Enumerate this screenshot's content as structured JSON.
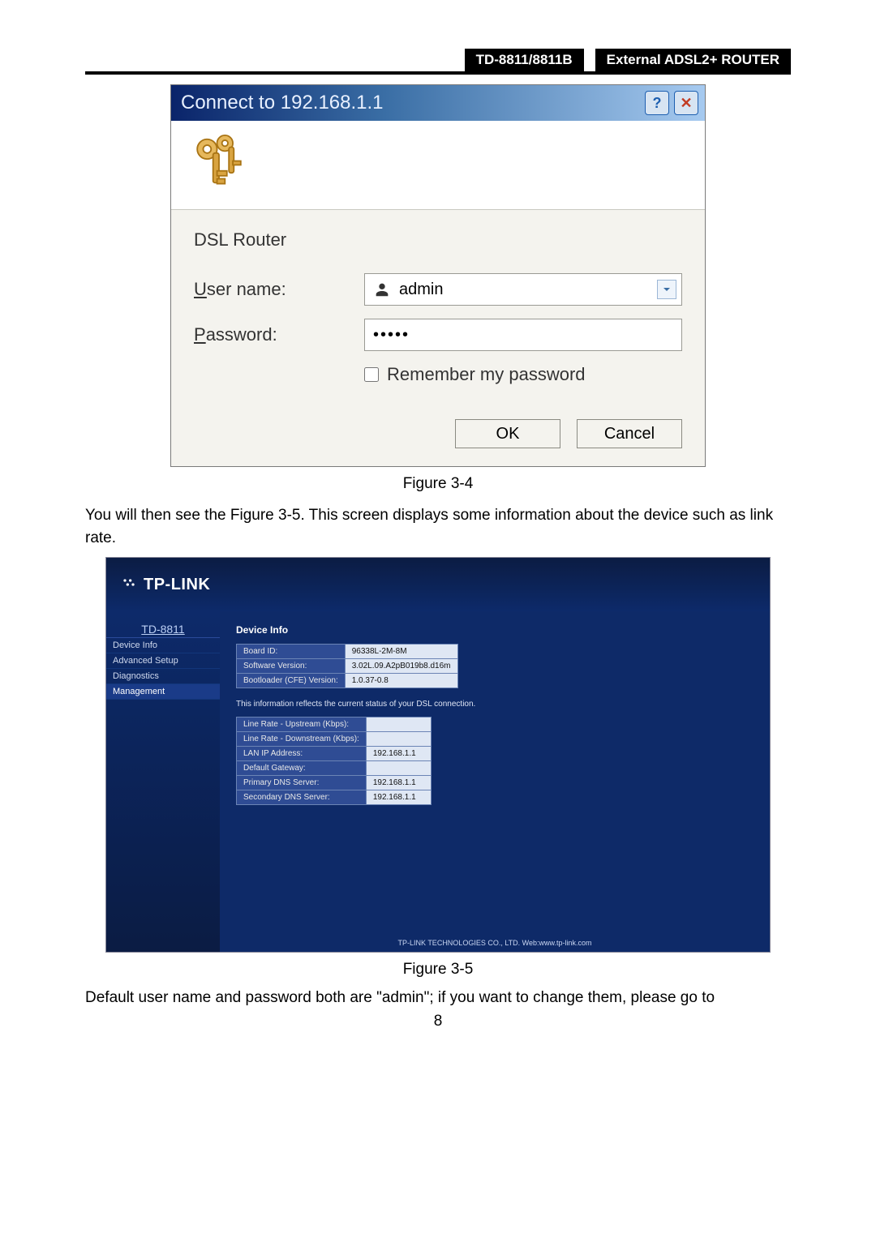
{
  "header": {
    "left": "TD-8811/8811B",
    "right": "External  ADSL2+  ROUTER"
  },
  "dialog34": {
    "title": "Connect to 192.168.1.1",
    "realm": "DSL Router",
    "username_label_pre": "U",
    "username_label_post": "ser name:",
    "password_label_pre": "P",
    "password_label_post": "assword:",
    "username_value": "admin",
    "password_value": "•••••",
    "remember_pre": "R",
    "remember_post": "emember my password",
    "ok": "OK",
    "cancel": "Cancel"
  },
  "caption34": "Figure 3-4",
  "para1": "You will then see the Figure 3-5. This screen displays some information about the device such as link rate.",
  "router35": {
    "logo": "TP-LINK",
    "model": "TD-8811",
    "nav": [
      "Device Info",
      "Advanced Setup",
      "Diagnostics",
      "Management"
    ],
    "title": "Device Info",
    "info_rows": [
      {
        "k": "Board ID:",
        "v": "96338L-2M-8M"
      },
      {
        "k": "Software Version:",
        "v": "3.02L.09.A2pB019b8.d16m"
      },
      {
        "k": "Bootloader (CFE) Version:",
        "v": "1.0.37-0.8"
      }
    ],
    "note": "This information reflects the current status of your DSL connection.",
    "status_rows": [
      {
        "k": "Line Rate - Upstream (Kbps):",
        "v": ""
      },
      {
        "k": "Line Rate - Downstream (Kbps):",
        "v": ""
      },
      {
        "k": "LAN IP Address:",
        "v": "192.168.1.1"
      },
      {
        "k": "Default Gateway:",
        "v": ""
      },
      {
        "k": "Primary DNS Server:",
        "v": "192.168.1.1"
      },
      {
        "k": "Secondary DNS Server:",
        "v": "192.168.1.1"
      }
    ],
    "footer": "TP-LINK TECHNOLOGIES CO., LTD. Web:www.tp-link.com"
  },
  "caption35": "Figure 3-5",
  "para2": "Default user name and password both are \"admin\"; if you want to change them, please go to",
  "pagenum": "8"
}
